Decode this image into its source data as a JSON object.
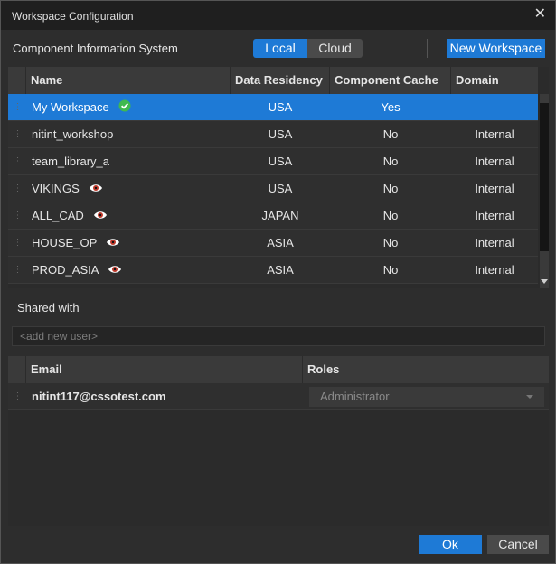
{
  "window": {
    "title": "Workspace Configuration",
    "close_label": "✕"
  },
  "toolbar": {
    "label": "Component Information System",
    "toggle": [
      "Local",
      "Cloud"
    ],
    "active": "Local",
    "new_workspace_label": "New Workspace"
  },
  "workspaces": {
    "headers": [
      "Name",
      "Data Residency",
      "Component Cache",
      "Domain"
    ],
    "rows": [
      {
        "name": "My Workspace",
        "residency": "USA",
        "cache": "Yes",
        "domain": "",
        "icon": "check-icon",
        "selected": true
      },
      {
        "name": "nitint_workshop",
        "residency": "USA",
        "cache": "No",
        "domain": "Internal",
        "icon": ""
      },
      {
        "name": "team_library_a",
        "residency": "USA",
        "cache": "No",
        "domain": "Internal",
        "icon": ""
      },
      {
        "name": "VIKINGS",
        "residency": "USA",
        "cache": "No",
        "domain": "Internal",
        "icon": "eye-icon"
      },
      {
        "name": "ALL_CAD",
        "residency": "JAPAN",
        "cache": "No",
        "domain": "Internal",
        "icon": "eye-icon"
      },
      {
        "name": "HOUSE_OP",
        "residency": "ASIA",
        "cache": "No",
        "domain": "Internal",
        "icon": "eye-icon"
      },
      {
        "name": "PROD_ASIA",
        "residency": "ASIA",
        "cache": "No",
        "domain": "Internal",
        "icon": "eye-icon"
      }
    ]
  },
  "shared": {
    "label": "Shared with",
    "add_placeholder": "<add new user>",
    "headers": [
      "Email",
      "Roles"
    ],
    "users": [
      {
        "email": "nitint117@cssotest.com",
        "role": "Administrator"
      }
    ]
  },
  "footer": {
    "ok_label": "Ok",
    "cancel_label": "Cancel"
  },
  "colors": {
    "accent": "#1e7ad6",
    "check": "#3fb950"
  }
}
